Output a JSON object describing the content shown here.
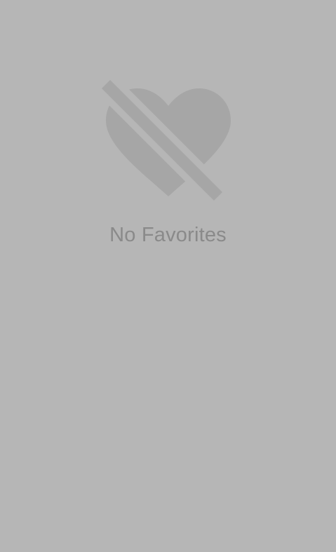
{
  "favorites": {
    "empty_state": {
      "icon": "heart-off-icon",
      "message": "No Favorites"
    }
  },
  "colors": {
    "background": "#b6b6b6",
    "icon": "#a6a6a6",
    "text": "#8a8a8a"
  }
}
